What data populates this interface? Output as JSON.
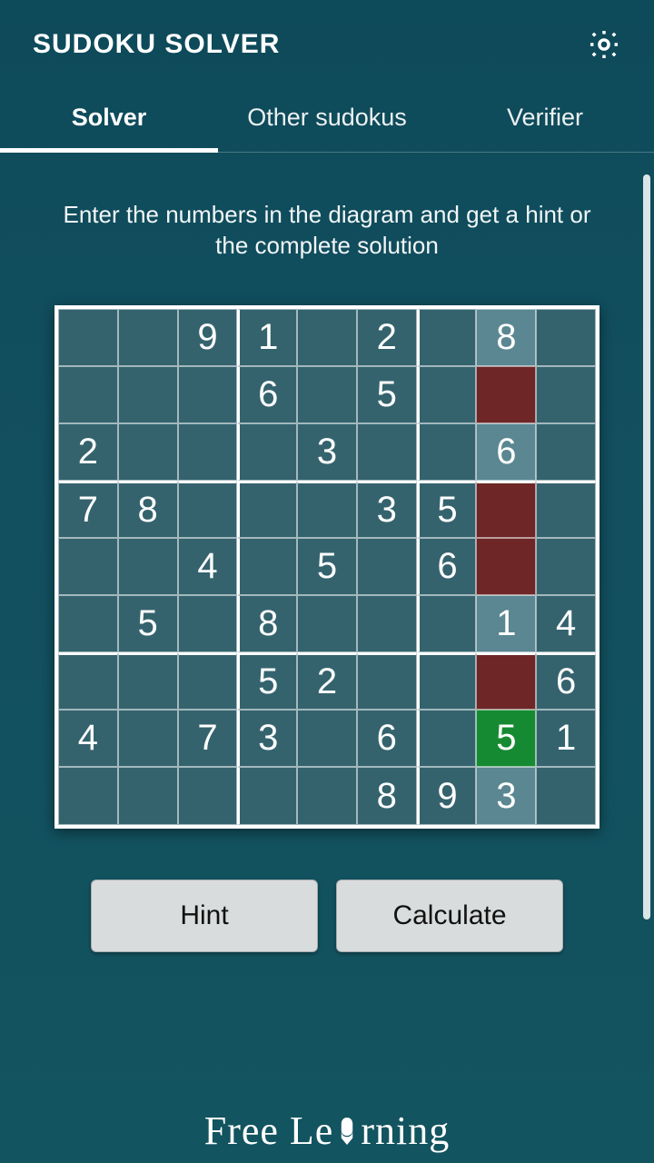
{
  "header": {
    "title": "SUDOKU SOLVER"
  },
  "tabs": [
    {
      "label": "Solver",
      "active": true
    },
    {
      "label": "Other sudokus",
      "active": false
    },
    {
      "label": "Verifier",
      "active": false
    }
  ],
  "instructions": "Enter the numbers in the diagram and get a hint or the complete solution",
  "board": {
    "cells": [
      [
        "",
        "",
        "9",
        "1",
        "",
        "2",
        "",
        "8",
        ""
      ],
      [
        "",
        "",
        "",
        "6",
        "",
        "5",
        "",
        "",
        ""
      ],
      [
        "2",
        "",
        "",
        "",
        "3",
        "",
        "",
        "6",
        ""
      ],
      [
        "7",
        "8",
        "",
        "",
        "",
        "3",
        "5",
        "",
        ""
      ],
      [
        "",
        "",
        "4",
        "",
        "5",
        "",
        "6",
        "",
        ""
      ],
      [
        "",
        "5",
        "",
        "8",
        "",
        "",
        "",
        "1",
        "4"
      ],
      [
        "",
        "",
        "",
        "5",
        "2",
        "",
        "",
        "",
        "6"
      ],
      [
        "4",
        "",
        "7",
        "3",
        "",
        "6",
        "",
        "5",
        "1"
      ],
      [
        "",
        "",
        "",
        "",
        "",
        "8",
        "9",
        "3",
        ""
      ]
    ],
    "highlights": {
      "0,7": "hl1",
      "1,7": "hl2",
      "2,7": "hl1",
      "3,7": "hl2",
      "4,7": "hl2",
      "5,7": "hl1",
      "6,7": "hl2",
      "7,7": "hl3",
      "8,7": "hl1"
    }
  },
  "buttons": {
    "hint": "Hint",
    "calculate": "Calculate"
  },
  "footer": {
    "brand_left": "Free Le",
    "brand_right": "rning"
  }
}
